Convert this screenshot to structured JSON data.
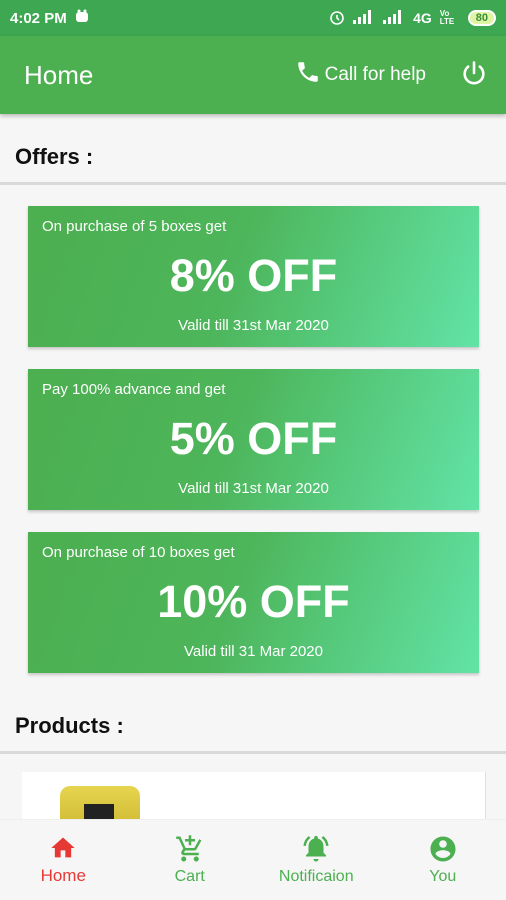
{
  "status_bar": {
    "time": "4:02 PM",
    "network": "4G",
    "volte": "Vo LTE",
    "battery": "80"
  },
  "app_bar": {
    "title": "Home",
    "help_label": "Call for help"
  },
  "offers_section": {
    "title": "Offers :",
    "items": [
      {
        "caption": "On purchase of 5 boxes get",
        "value": "8% OFF",
        "valid": "Valid till 31st Mar 2020"
      },
      {
        "caption": "Pay 100% advance and get",
        "value": "5% OFF",
        "valid": "Valid till 31st Mar 2020"
      },
      {
        "caption": "On purchase of 10 boxes get",
        "value": "10% OFF",
        "valid": "Valid till 31 Mar 2020"
      }
    ]
  },
  "products_section": {
    "title": "Products :"
  },
  "bottom_nav": {
    "items": [
      {
        "label": "Home",
        "icon": "home-icon",
        "active": true
      },
      {
        "label": "Cart",
        "icon": "cart-add-icon"
      },
      {
        "label": "Notificaion",
        "icon": "bell-icon"
      },
      {
        "label": "You",
        "icon": "user-icon"
      }
    ]
  },
  "colors": {
    "primary": "#4caf50",
    "status_bar": "#3da751",
    "active_nav": "#e53935",
    "offer_gradient_end": "#62e3a6"
  }
}
